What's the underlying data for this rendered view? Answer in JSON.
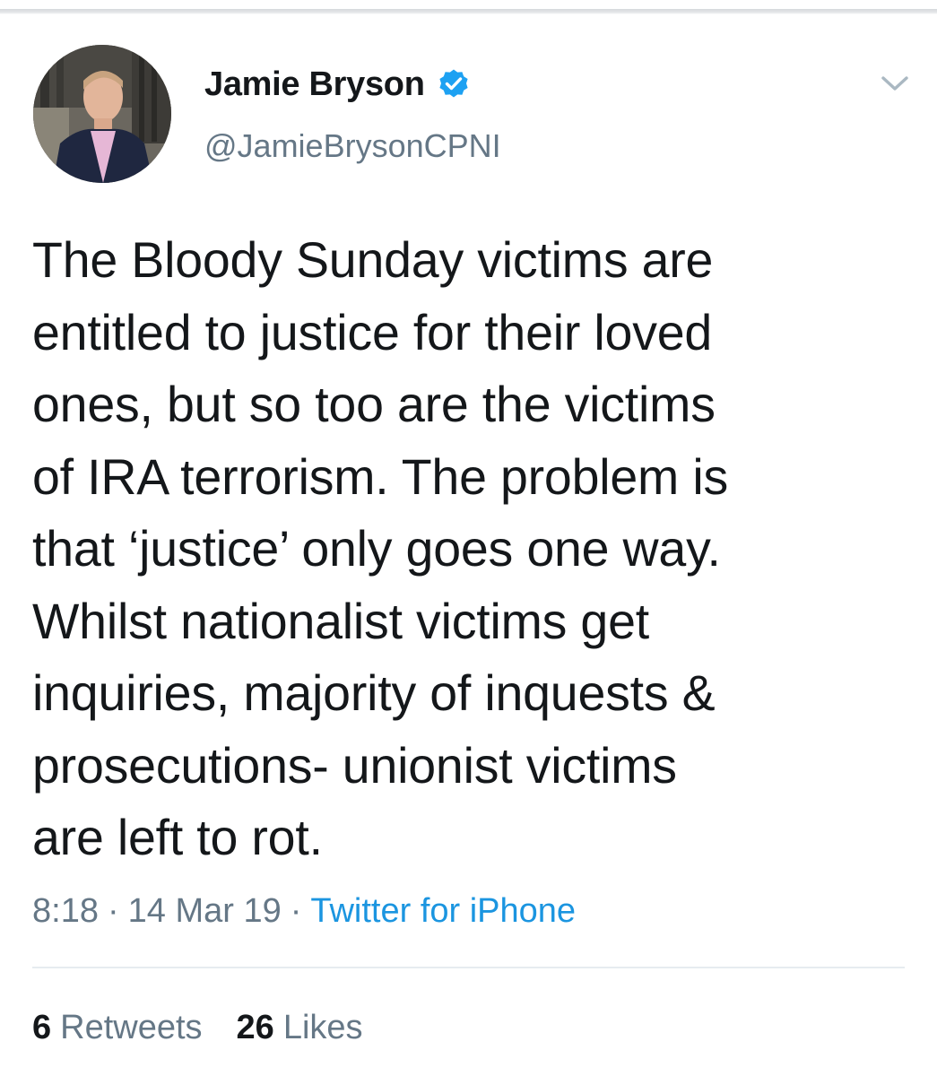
{
  "tweet": {
    "display_name": "Jamie Bryson",
    "handle": "@JamieBrysonCPNI",
    "text": "The Bloody Sunday victims are\nentitled to justice for their loved\nones, but so too are the victims\nof IRA terrorism. The problem is\nthat ‘justice’ only goes one way.\nWhilst nationalist victims get\ninquiries, majority of inquests &\nprosecutions- unionist victims\nare left to rot.",
    "time": "8:18",
    "separator": "·",
    "date": "14 Mar 19",
    "source": "Twitter for iPhone",
    "retweets_count": "6",
    "retweets_label": "Retweets",
    "likes_count": "26",
    "likes_label": "Likes"
  },
  "icons": {
    "verified": "verified-badge-icon",
    "caret": "chevron-down-icon"
  },
  "colors": {
    "text_primary": "#14171a",
    "text_secondary": "#657786",
    "link": "#1b95e0",
    "verified": "#1da1f2",
    "divider": "#e6ecf0"
  }
}
